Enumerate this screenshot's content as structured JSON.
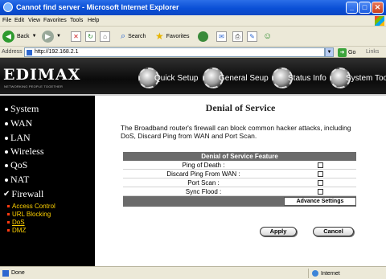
{
  "window": {
    "title": "Cannot find server - Microsoft Internet Explorer"
  },
  "menubar": [
    "File",
    "Edit",
    "View",
    "Favorites",
    "Tools",
    "Help"
  ],
  "toolbar": {
    "back": "Back",
    "search": "Search",
    "favorites": "Favorites"
  },
  "address": {
    "label": "Address",
    "url": "http://192.168.2.1",
    "go": "Go",
    "links": "Links"
  },
  "router": {
    "logo": "EDIMAX",
    "tagline": "NETWORKING PEOPLE TOGETHER",
    "nav": [
      "Quick Setup",
      "General Seup",
      "Status Info",
      "System Tools"
    ],
    "menu": [
      "System",
      "WAN",
      "LAN",
      "Wireless",
      "QoS",
      "NAT",
      "Firewall"
    ],
    "submenu": [
      "Access Control",
      "URL Blocking",
      "DoS",
      "DMZ"
    ],
    "active_submenu": "DoS"
  },
  "page": {
    "title": "Denial of Service",
    "description": "The Broadband router's firewall can block common hacker attacks, including DoS, Discard Ping from WAN and Port Scan.",
    "panel_title": "Denial of Service Feature",
    "features": [
      {
        "label": "Ping of Death :",
        "checked": false
      },
      {
        "label": "Discard Ping From WAN :",
        "checked": false
      },
      {
        "label": "Port Scan :",
        "checked": false
      },
      {
        "label": "Sync Flood :",
        "checked": false
      }
    ],
    "advance_button": "Advance Settings",
    "apply_button": "Apply",
    "cancel_button": "Cancel"
  },
  "status": {
    "text": "Done",
    "zone": "Internet"
  },
  "colors": {
    "titlebar": "#0a4fd6",
    "sidebar": "#000000",
    "submenu_text": "#ffd200",
    "panel_header": "#6b6b6b"
  }
}
